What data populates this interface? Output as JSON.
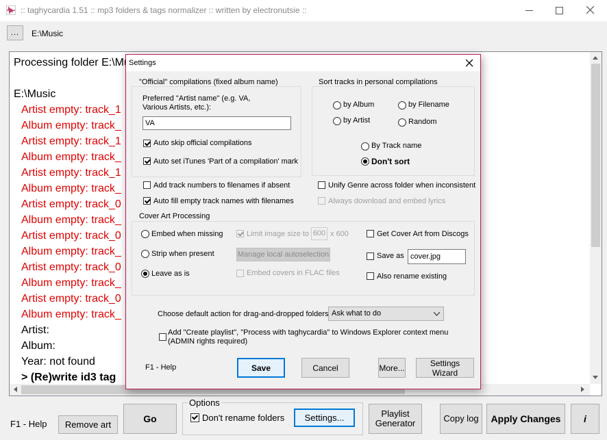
{
  "window": {
    "title": ":: taghycardia 1.51 :: mp3 folders & tags normalizer :: written by electronutsie ::",
    "path_button": "...",
    "path": "E:\\Music"
  },
  "log": {
    "lines": [
      {
        "text": "Processing folder E:\\Mu",
        "style": "normal"
      },
      {
        "text": "",
        "style": "normal"
      },
      {
        "text": "E:\\Music",
        "style": "normal"
      },
      {
        "text": "Artist empty: track_1",
        "style": "red"
      },
      {
        "text": "Album empty: track_",
        "style": "red"
      },
      {
        "text": "Artist empty: track_1",
        "style": "red"
      },
      {
        "text": "Album empty: track_",
        "style": "red"
      },
      {
        "text": "Artist empty: track_1",
        "style": "red"
      },
      {
        "text": "Album empty: track_",
        "style": "red"
      },
      {
        "text": "Artist empty: track_0",
        "style": "red"
      },
      {
        "text": "Album empty: track_",
        "style": "red"
      },
      {
        "text": "Artist empty: track_0",
        "style": "red"
      },
      {
        "text": "Album empty: track_",
        "style": "red"
      },
      {
        "text": "Artist empty: track_0",
        "style": "red"
      },
      {
        "text": "Album empty: track_",
        "style": "red"
      },
      {
        "text": "Artist empty: track_0",
        "style": "red"
      },
      {
        "text": "Album empty: track_",
        "style": "red"
      },
      {
        "text": "Artist:",
        "style": "normal"
      },
      {
        "text": "Album:",
        "style": "normal"
      },
      {
        "text": "Year: not found",
        "style": "normal"
      },
      {
        "text": "> (Re)write id3 tag",
        "style": "bold"
      }
    ]
  },
  "bottom": {
    "help": "F1 - Help",
    "remove_art": "Remove art",
    "go": "Go",
    "options_label": "Options",
    "dont_rename": "Don't rename folders",
    "settings": "Settings...",
    "playlist_generator": "Playlist Generator",
    "copy_log": "Copy log",
    "apply_changes": "Apply Changes",
    "info": "i"
  },
  "dialog": {
    "title": "Settings",
    "official_group": "\"Official\" compilations (fixed album name)",
    "preferred_artist": "Preferred \"Artist name\" (e.g. VA, Various Artists, etc.):",
    "preferred_artist_value": "VA",
    "auto_skip": "Auto skip official compilations",
    "auto_set_itunes": "Auto set iTunes 'Part of a compilation' mark",
    "sort_group": "Sort tracks in personal compilations",
    "by_album": "by Album",
    "by_filename": "by Filename",
    "by_artist": "by Artist",
    "random": "Random",
    "by_track_name": "By Track name",
    "dont_sort": "Don't sort",
    "add_track_numbers": "Add track numbers to filenames if absent",
    "unify_genre": "Unify Genre across folder when inconsistent",
    "auto_fill": "Auto fill empty track names with filenames",
    "always_download": "Always download and embed lyrics",
    "cover_group": "Cover Art Processing",
    "embed_missing": "Embed when missing",
    "strip_present": "Strip when present",
    "leave_as_is": "Leave as is",
    "limit_size": "Limit image size to",
    "size_value": "600",
    "size_suffix": "x 600",
    "manage_local": "Manage local autoselection",
    "embed_flac": "Embed covers in FLAC files",
    "get_discogs": "Get Cover Art from Discogs",
    "save_as": "Save as",
    "save_as_value": "cover.jpg",
    "also_rename": "Also rename existing",
    "default_action_label": "Choose default action for drag-and-dropped folders:",
    "default_action_value": "Ask what to do",
    "context_menu": "Add \"Create playlist\", \"Process with taghycardia\" to Windows Explorer context menu (ADMIN rights required)",
    "help": "F1 - Help",
    "save": "Save",
    "cancel": "Cancel",
    "more": "More...",
    "wizard": "Settings Wizard"
  }
}
